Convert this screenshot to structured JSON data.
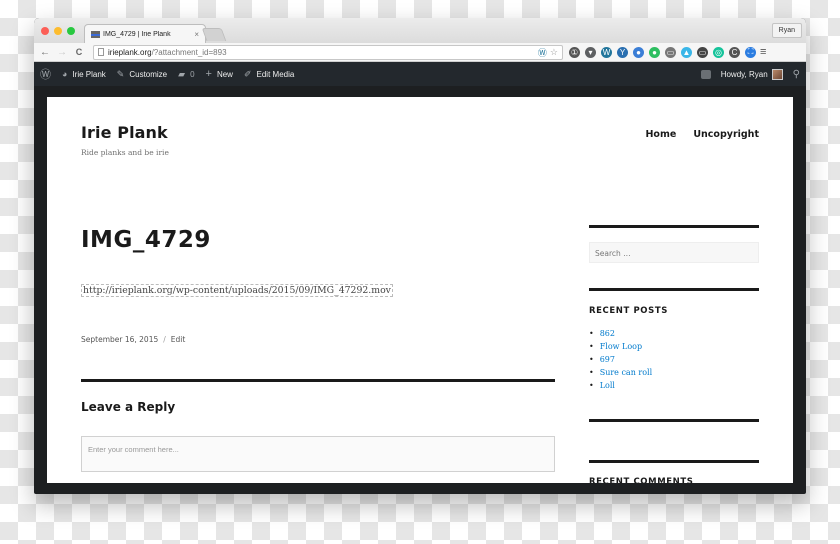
{
  "browser": {
    "tab": {
      "title": "IMG_4729 | Irie Plank",
      "close_glyph": "×"
    },
    "profile_name": "Ryan",
    "nav": {
      "back": "←",
      "forward": "→",
      "reload": "C"
    },
    "url": {
      "host": "irieplank.org",
      "path": "/?attachment_id=893"
    },
    "omnibox_icons": [
      "wordpress-icon",
      "star-icon"
    ],
    "extensions": [
      {
        "name": "1password-icon",
        "glyph": "①",
        "color": "#555555"
      },
      {
        "name": "pocket-icon",
        "glyph": "▾",
        "color": "#5e6062"
      },
      {
        "name": "wordpress-icon",
        "glyph": "W",
        "color": "#21759b"
      },
      {
        "name": "yoast-icon",
        "glyph": "Y",
        "color": "#2a6fb0"
      },
      {
        "name": "globe-icon",
        "glyph": "●",
        "color": "#3b7ed6"
      },
      {
        "name": "evernote-icon",
        "glyph": "●",
        "color": "#2dbe60"
      },
      {
        "name": "cast-icon",
        "glyph": "▭",
        "color": "#777777"
      },
      {
        "name": "ghostery-icon",
        "glyph": "▲",
        "color": "#3ab6e8"
      },
      {
        "name": "screen-share-icon",
        "glyph": "▭",
        "color": "#444444"
      },
      {
        "name": "grammarly-icon",
        "glyph": "◎",
        "color": "#15c39a"
      },
      {
        "name": "c-extension-icon",
        "glyph": "C",
        "color": "#555555"
      },
      {
        "name": "screenshot-icon",
        "glyph": "⛶",
        "color": "#2b7de1"
      }
    ],
    "menu_glyph": "≡"
  },
  "adminbar": {
    "items": [
      {
        "label": "Irie Plank",
        "icon": "dashboard-icon"
      },
      {
        "label": "Customize",
        "icon": "brush-icon"
      },
      {
        "label": "0",
        "icon": "comment-icon"
      },
      {
        "label": "New",
        "icon": "plus-icon"
      },
      {
        "label": "Edit Media",
        "icon": "pencil-icon"
      }
    ],
    "greeting": "Howdy, Ryan"
  },
  "site": {
    "title": "Irie Plank",
    "description": "Ride planks and be irie",
    "nav": [
      "Home",
      "Uncopyright"
    ]
  },
  "post": {
    "title": "IMG_4729",
    "attachment_url": "http://irieplank.org/wp-content/uploads/2015/09/IMG_47292.mov",
    "date": "September 16, 2015",
    "separator": "/",
    "edit_label": "Edit"
  },
  "comments": {
    "heading": "Leave a Reply",
    "placeholder": "Enter your comment here..."
  },
  "sidebar": {
    "search_placeholder": "Search …",
    "recent_posts_heading": "RECENT POSTS",
    "recent_posts": [
      "862",
      "Flow Loop",
      "697",
      "Sure can roll",
      "Loll"
    ],
    "recent_comments_heading": "RECENT COMMENTS"
  }
}
